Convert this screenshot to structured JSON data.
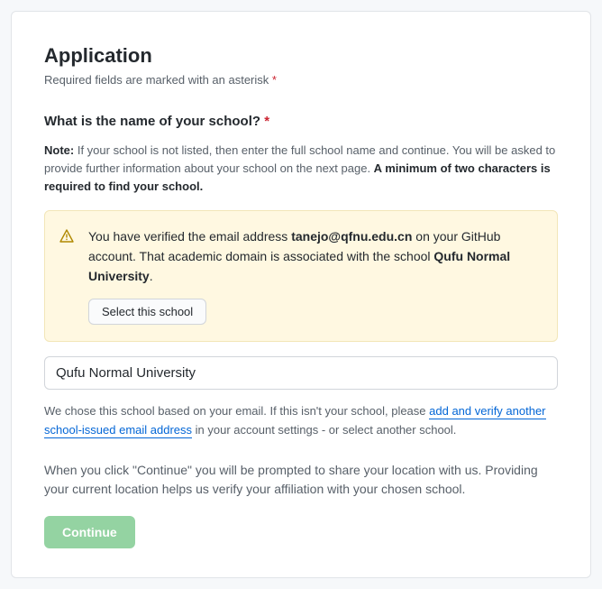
{
  "header": {
    "title": "Application",
    "subheading": "Required fields are marked with an asterisk",
    "asterisk": "*"
  },
  "question": {
    "label": "What is the name of your school?",
    "asterisk": "*"
  },
  "note": {
    "prefix": "Note:",
    "body": " If your school is not listed, then enter the full school name and continue. You will be asked to provide further information about your school on the next page. ",
    "bold_tail": "A minimum of two characters is required to find your school."
  },
  "alert": {
    "pre_email": "You have verified the email address ",
    "email": "tanejo@qfnu.edu.cn",
    "post_email": " on your GitHub account. That academic domain is associated with the school ",
    "school": "Qufu Normal University",
    "period": ".",
    "select_button": "Select this school"
  },
  "input": {
    "value": "Qufu Normal University"
  },
  "help": {
    "pre": "We chose this school based on your email. If this isn't your school, please ",
    "link": "add and verify another school-issued email address",
    "post": " in your account settings - or select another school."
  },
  "continue_text": "When you click \"Continue\" you will be prompted to share your location with us. Providing your current location helps us verify your affiliation with your chosen school.",
  "continue_button": "Continue"
}
